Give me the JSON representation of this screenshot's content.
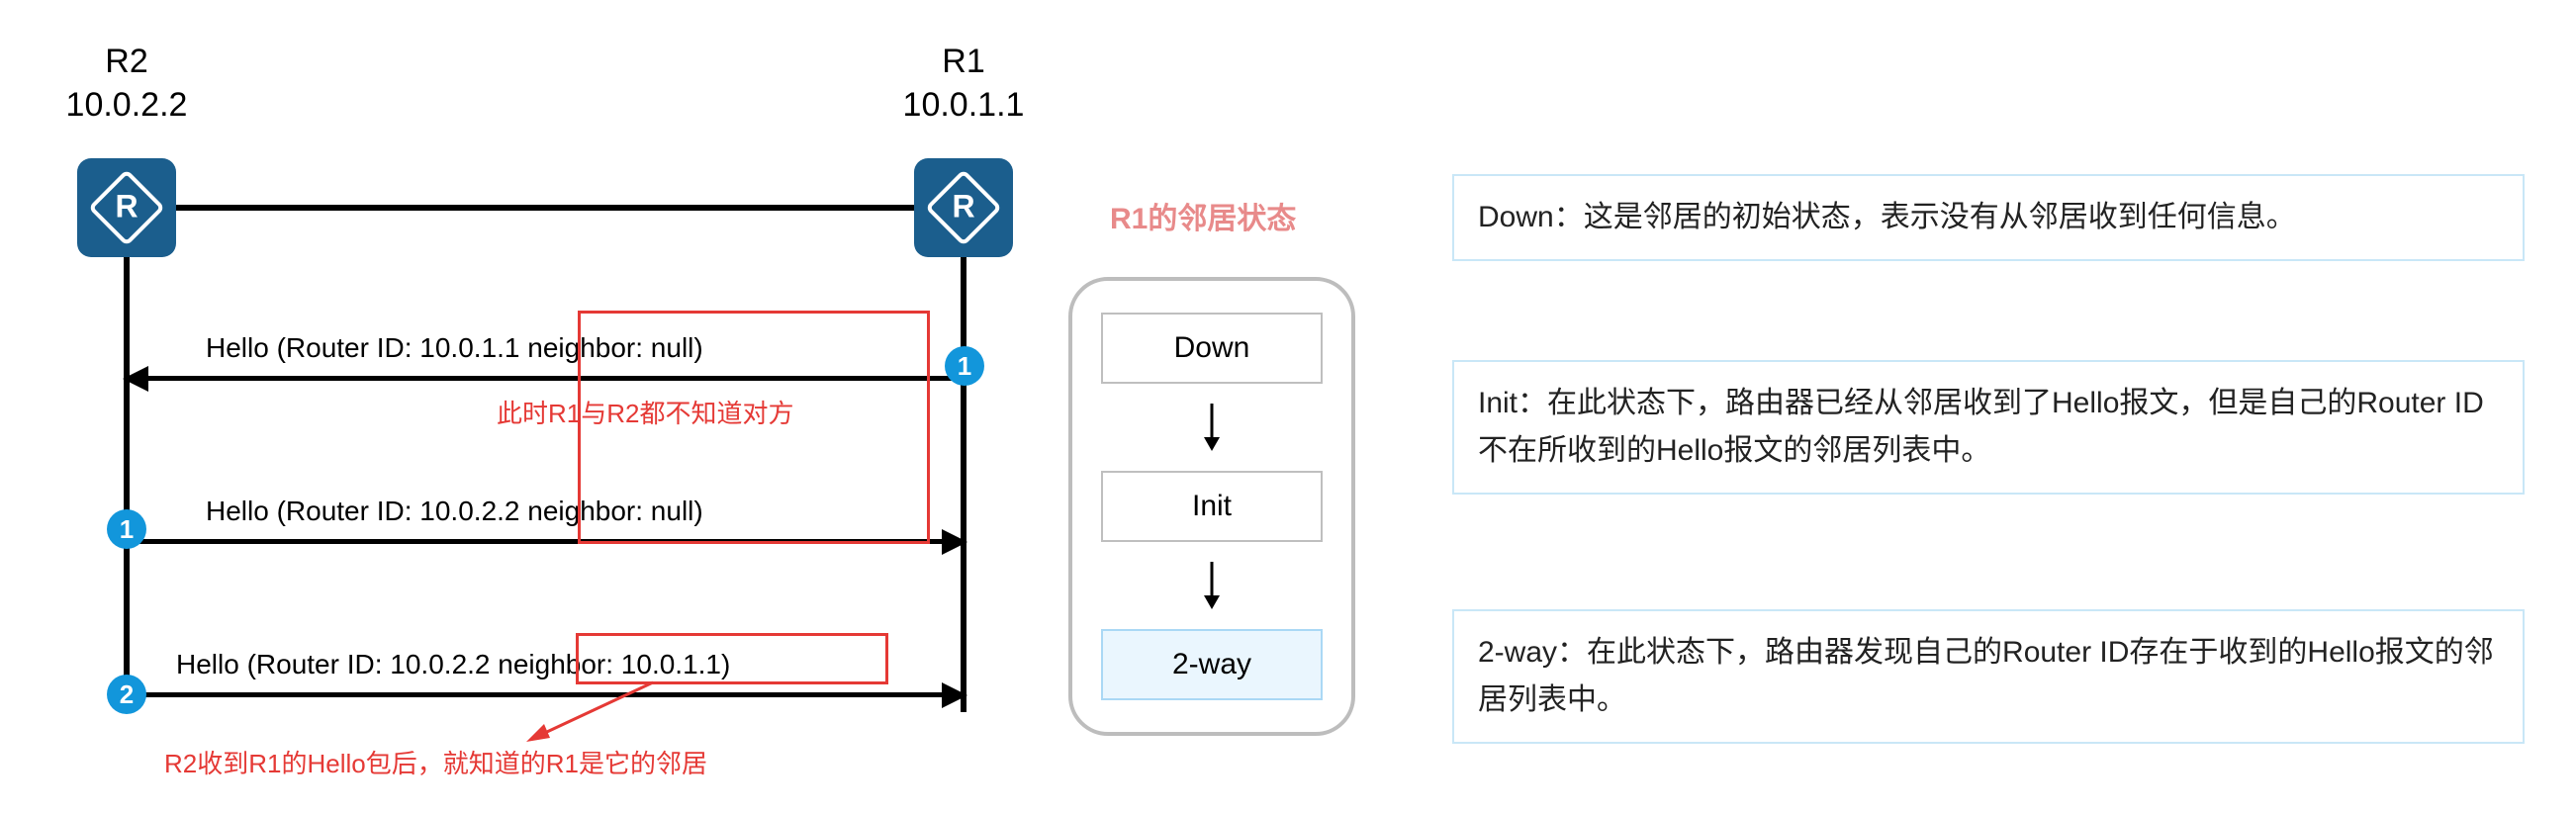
{
  "routers": {
    "r2": {
      "name": "R2",
      "ip": "10.0.2.2"
    },
    "r1": {
      "name": "R1",
      "ip": "10.0.1.1"
    }
  },
  "messages": {
    "m1": "Hello (Router ID: 10.0.1.1  neighbor: null)",
    "m2": "Hello (Router ID: 10.0.2.2  neighbor: null)",
    "m3": "Hello (Router ID: 10.0.2.2  neighbor: 10.0.1.1)"
  },
  "badges": {
    "r1_after_m1": "1",
    "r2_after_m2": "1",
    "r2_after_m3": "2"
  },
  "annotations": {
    "line1": "此时R1与R2都不知道对方",
    "line2": "R2收到R1的Hello包后，就知道的R1是它的邻居"
  },
  "states": {
    "title": "R1的邻居状态",
    "down": "Down",
    "init": "Init",
    "two_way": "2-way"
  },
  "descriptions": {
    "down": "Down：这是邻居的初始状态，表示没有从邻居收到任何信息。",
    "init": "Init：在此状态下，路由器已经从邻居收到了Hello报文，但是自己的Router ID不在所收到的Hello报文的邻居列表中。",
    "two_way": "2-way：在此状态下，路由器发现自己的Router ID存在于收到的Hello报文的邻居列表中。"
  },
  "chart_data": {
    "type": "sequence-diagram",
    "participants": [
      {
        "id": "R2",
        "label": "R2",
        "ip": "10.0.2.2"
      },
      {
        "id": "R1",
        "label": "R1",
        "ip": "10.0.1.1"
      }
    ],
    "messages": [
      {
        "from": "R1",
        "to": "R2",
        "text": "Hello (Router ID: 10.0.1.1, neighbor: null)",
        "r1_badge_after": 1
      },
      {
        "from": "R2",
        "to": "R1",
        "text": "Hello (Router ID: 10.0.2.2, neighbor: null)",
        "r2_badge_after": 1,
        "note": "此时R1与R2都不知道对方"
      },
      {
        "from": "R2",
        "to": "R1",
        "text": "Hello (Router ID: 10.0.2.2, neighbor: 10.0.1.1)",
        "r2_badge_after": 2,
        "note": "R2收到R1的Hello包后，就知道的R1是它的邻居"
      }
    ],
    "r1_neighbor_state_machine": [
      "Down",
      "Init",
      "2-way"
    ],
    "state_descriptions": {
      "Down": "这是邻居的初始状态，表示没有从邻居收到任何信息。",
      "Init": "在此状态下，路由器已经从邻居收到了Hello报文，但是自己的Router ID不在所收到的Hello报文的邻居列表中。",
      "2-way": "在此状态下，路由器发现自己的Router ID存在于收到的Hello报文的邻居列表中。"
    }
  }
}
